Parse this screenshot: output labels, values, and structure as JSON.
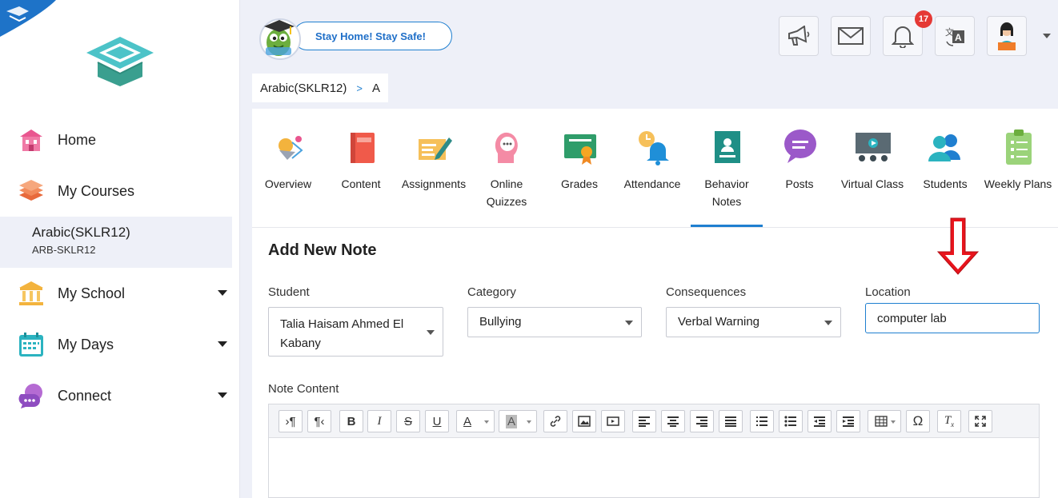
{
  "sidebar": {
    "nav": [
      {
        "label": "Home",
        "icon": "home-icon"
      },
      {
        "label": "My Courses",
        "icon": "courses-icon"
      },
      {
        "label": "My School",
        "icon": "school-icon"
      },
      {
        "label": "My Days",
        "icon": "calendar-icon"
      },
      {
        "label": "Connect",
        "icon": "connect-icon"
      }
    ],
    "active_course": {
      "name": "Arabic(SKLR12)",
      "code": "ARB-SKLR12"
    }
  },
  "header": {
    "banner": "Stay Home! Stay Safe!",
    "notification_count": "17",
    "buttons": [
      "megaphone-icon",
      "mail-icon",
      "bell-icon",
      "translate-icon",
      "profile-avatar"
    ]
  },
  "breadcrumb": {
    "course": "Arabic(SKLR12)",
    "separator": ">",
    "section": "A"
  },
  "tabs": [
    {
      "label": "Overview",
      "icon": "overview-icon"
    },
    {
      "label": "Content",
      "icon": "book-icon"
    },
    {
      "label": "Assignments",
      "icon": "assignment-icon"
    },
    {
      "label": "Online Quizzes",
      "icon": "quiz-icon"
    },
    {
      "label": "Grades",
      "icon": "grades-icon"
    },
    {
      "label": "Attendance",
      "icon": "attendance-icon"
    },
    {
      "label": "Behavior Notes",
      "icon": "behavior-notes-icon",
      "active": true
    },
    {
      "label": "Posts",
      "icon": "posts-icon"
    },
    {
      "label": "Virtual Class",
      "icon": "virtual-class-icon"
    },
    {
      "label": "Students",
      "icon": "students-icon"
    },
    {
      "label": "Weekly Plans",
      "icon": "weekly-plans-icon"
    }
  ],
  "form": {
    "title": "Add New Note",
    "student_label": "Student",
    "student_value": "Talia Haisam Ahmed El Kabany",
    "category_label": "Category",
    "category_value": "Bullying",
    "consequences_label": "Consequences",
    "consequences_value": "Verbal Warning",
    "location_label": "Location",
    "location_value": "computer lab",
    "note_content_label": "Note Content"
  },
  "colors": {
    "accent": "#1f7fd0",
    "badge": "#e53935",
    "arrow": "#e8141c"
  }
}
